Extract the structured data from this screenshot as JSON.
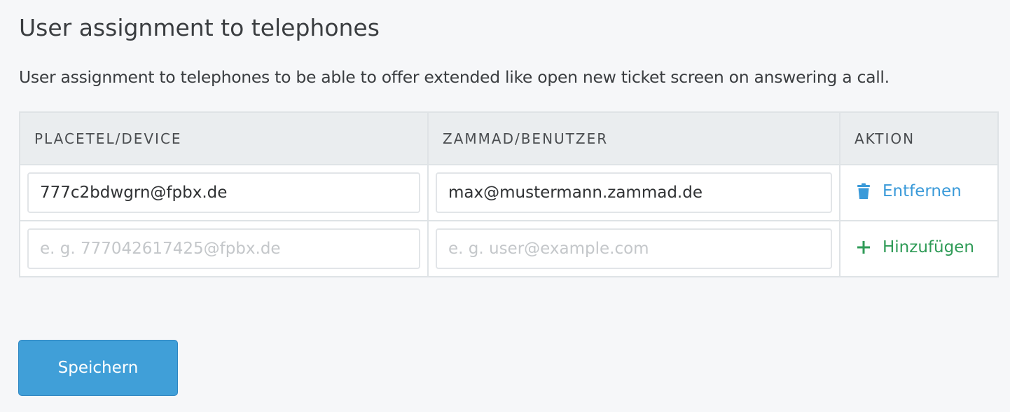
{
  "page": {
    "title": "User assignment to telephones",
    "description": "User assignment to telephones to be able to offer extended like open new ticket screen on answering a call."
  },
  "table": {
    "headers": [
      "PLACETEL/DEVICE",
      "ZAMMAD/BENUTZER",
      "AKTION"
    ],
    "rows": [
      {
        "device_value": "777c2bdwgrn@fpbx.de",
        "user_value": "max@mustermann.zammad.de",
        "action_label": "Entfernen",
        "action_icon": "trash-icon"
      }
    ],
    "new_row": {
      "device_placeholder": "e. g. 777042617425@fpbx.de",
      "user_placeholder": "e. g. user@example.com",
      "action_label": "Hinzufügen",
      "action_icon": "plus-icon"
    }
  },
  "buttons": {
    "save_label": "Speichern"
  },
  "colors": {
    "background": "#f6f7f9",
    "remove_action": "#3a9ad9",
    "add_action": "#2f9b57",
    "primary_button": "#409fd8"
  }
}
